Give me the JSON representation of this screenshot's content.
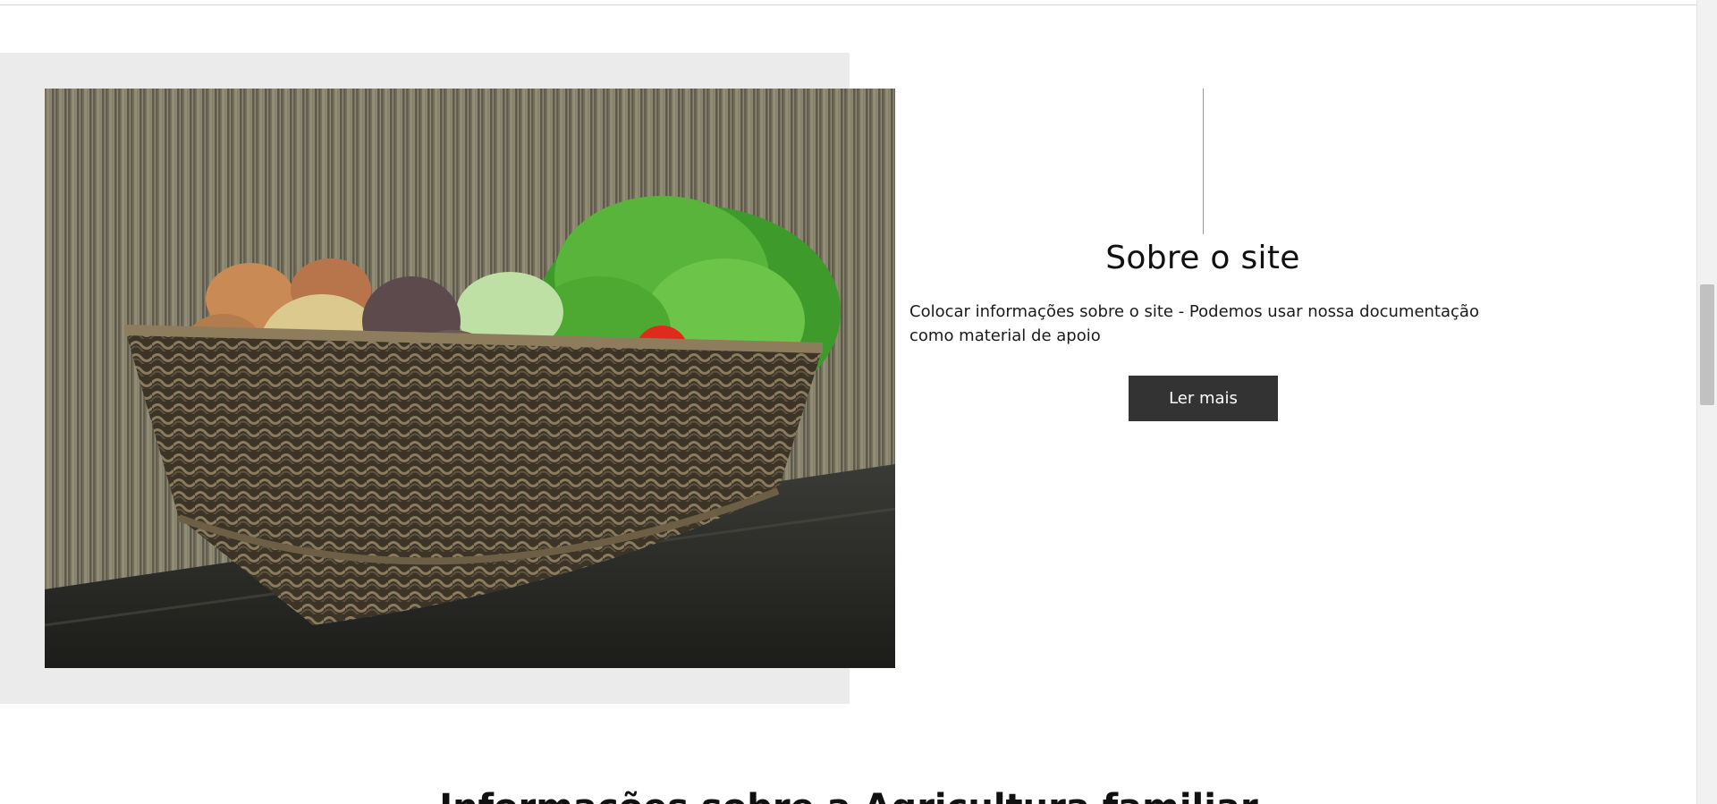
{
  "about": {
    "title": "Sobre o site",
    "text": "Colocar informações sobre o site - Podemos usar nossa documentação como material de apoio",
    "button_label": "Ler mais",
    "image_alt": "vegetables-basket-photo"
  },
  "next_section": {
    "heading": "Informações sobre a Agricultura familiar"
  },
  "colors": {
    "panel": "#ebebeb",
    "button_bg": "#333333",
    "button_text": "#ffffff",
    "text": "#111111"
  }
}
